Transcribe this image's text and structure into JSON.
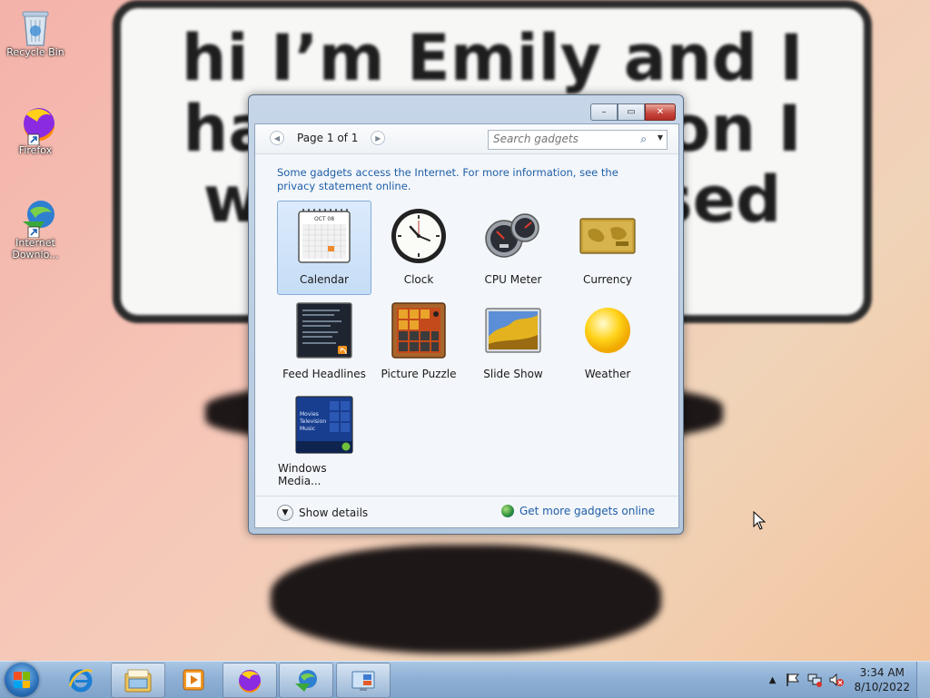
{
  "wallpaper": {
    "speech_text": "hi I’m Emily and I\nhave a question I\nwant to be used"
  },
  "desktop_icons": [
    {
      "label": "Recycle Bin",
      "icon": "recycle-bin-icon"
    },
    {
      "label": "Firefox",
      "icon": "firefox-icon"
    },
    {
      "label": "Internet Downlo...",
      "icon": "internet-download-manager-icon"
    }
  ],
  "gadget_gallery": {
    "window_controls": {
      "minimize": "–",
      "maximize": "▭",
      "close": "✕"
    },
    "pager": {
      "prev": "◀",
      "label": "Page 1 of 1",
      "next": "▶"
    },
    "search": {
      "placeholder": "Search gadgets",
      "value": ""
    },
    "info_text": "Some gadgets access the Internet.  For more information, see the privacy statement online.",
    "gadgets": [
      {
        "label": "Calendar",
        "icon": "calendar-icon",
        "selected": true
      },
      {
        "label": "Clock",
        "icon": "clock-icon",
        "selected": false
      },
      {
        "label": "CPU Meter",
        "icon": "cpu-meter-icon",
        "selected": false
      },
      {
        "label": "Currency",
        "icon": "currency-icon",
        "selected": false
      },
      {
        "label": "Feed Headlines",
        "icon": "feed-headlines-icon",
        "selected": false
      },
      {
        "label": "Picture Puzzle",
        "icon": "picture-puzzle-icon",
        "selected": false
      },
      {
        "label": "Slide Show",
        "icon": "slide-show-icon",
        "selected": false
      },
      {
        "label": "Weather",
        "icon": "weather-icon",
        "selected": false
      },
      {
        "label": "Windows Media...",
        "icon": "windows-media-center-icon",
        "selected": false
      }
    ],
    "calendar_month": "OCT 08",
    "media_center_lines": [
      "Movies",
      "Television",
      "Music"
    ],
    "footer": {
      "show_details": "Show details",
      "get_more": "Get more gadgets online"
    }
  },
  "taskbar": {
    "pinned": [
      "internet-explorer-icon",
      "windows-explorer-icon",
      "media-player-icon",
      "firefox-icon",
      "internet-download-manager-icon",
      "gadgets-icon"
    ],
    "clock_time": "3:34 AM",
    "clock_date": "8/10/2022"
  },
  "colors": {
    "link": "#1f5fa8",
    "selection": "#c6ddf6",
    "taskbar": "#8fb1d6"
  }
}
